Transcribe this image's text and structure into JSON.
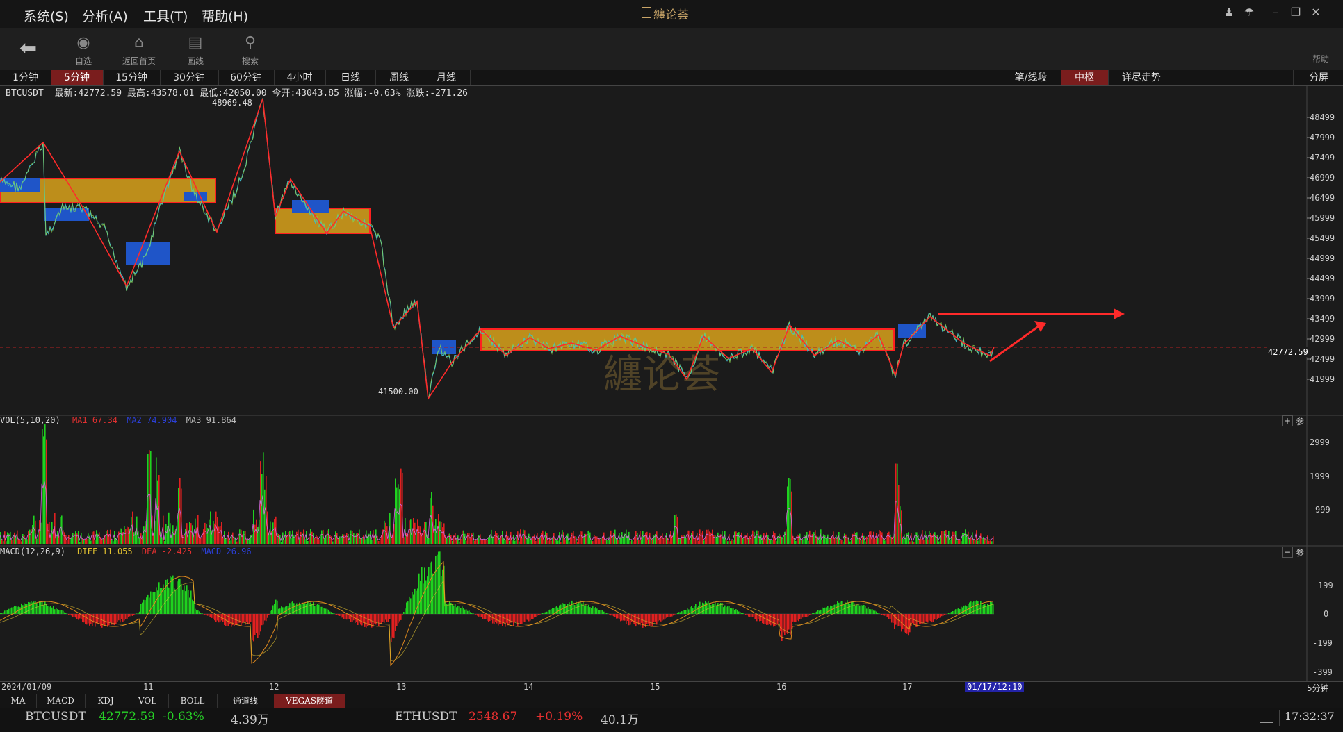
{
  "menu": {
    "items": [
      "系统(S)",
      "分析(A)",
      "工具(T)",
      "帮助(H)"
    ],
    "app_title": "纏论荟"
  },
  "toolbar": {
    "items": [
      {
        "label": "自选",
        "icon": "watchlist-icon"
      },
      {
        "label": "返回首页",
        "icon": "home-icon"
      },
      {
        "label": "画线",
        "icon": "draw-line-icon"
      },
      {
        "label": "搜索",
        "icon": "search-icon"
      }
    ],
    "help": "帮助"
  },
  "periods": [
    "1分钟",
    "5分钟",
    "15分钟",
    "30分钟",
    "60分钟",
    "4小时",
    "日线",
    "周线",
    "月线"
  ],
  "active_period": "5分钟",
  "right_tabs": [
    "笔/线段",
    "中枢",
    "详尽走势"
  ],
  "active_right_tab": "中枢",
  "split_label": "分屏",
  "symbol_info": {
    "symbol": "BTCUSDT",
    "latest": "最新:42772.59",
    "high": "最高:43578.01",
    "low": "最低:42050.00",
    "open": "今开:43043.85",
    "change_pct": "涨幅:-0.63%",
    "change": "涨跌:-271.26"
  },
  "price_axis": [
    "48499",
    "47999",
    "47499",
    "46999",
    "46499",
    "45999",
    "45499",
    "44999",
    "44499",
    "43999",
    "43499",
    "42999",
    "42499",
    "41999"
  ],
  "price_labels": {
    "high": "48969.48",
    "low": "41500.00",
    "current": "42772.59"
  },
  "vol_panel": {
    "title": "VOL(5,10,20)",
    "ma1": "MA1 67.34",
    "ma2": "MA2 74.904",
    "ma3": "MA3 91.864",
    "axis": [
      "2999",
      "1999",
      "999"
    ],
    "plus": "+",
    "param": "参"
  },
  "macd_panel": {
    "title": "MACD(12,26,9)",
    "diff": "DIFF 11.055",
    "dea": "DEA -2.425",
    "macd": "MACD 26.96",
    "axis": [
      "199",
      "0",
      "-199",
      "-399"
    ],
    "minus": "−",
    "param": "参"
  },
  "date_axis": {
    "labels": [
      "2024/01/09",
      "11",
      "12",
      "13",
      "14",
      "15",
      "16",
      "17"
    ],
    "cursor": "01/17/12:10",
    "period": "5分钟"
  },
  "indicator_tabs": [
    "MA",
    "MACD",
    "KDJ",
    "VOL",
    "BOLL",
    "通道线",
    "VEGAS隧道"
  ],
  "active_indicator": "VEGAS隧道",
  "status": {
    "sym1": "BTCUSDT",
    "price1": "42772.59",
    "chg1": "-0.63%",
    "vol1": "4.39万",
    "sym2": "ETHUSDT",
    "price2": "2548.67",
    "chg2": "+0.19%",
    "vol2": "40.1万",
    "time": "17:32:37"
  },
  "watermark": "纏论荟",
  "colors": {
    "up": "#e02020",
    "down": "#1fd21f",
    "zone": "#d9a21b",
    "zone_border": "#ff2020",
    "box_blue": "#1f55c8",
    "active_tab": "#7a1d1d"
  }
}
